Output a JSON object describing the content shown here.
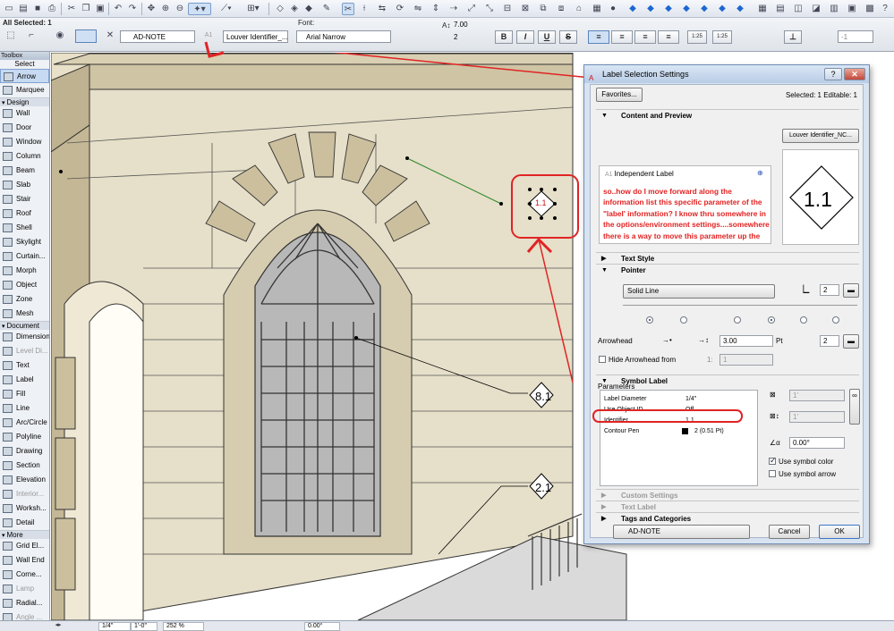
{
  "toolbar": {
    "info_title": "All Selected: 1",
    "layer_value": "AD-NOTE",
    "label_type": "Louver Identifier_...",
    "font_caption": "Font:",
    "font_value": "Arial Narrow",
    "size_value": "7.00",
    "pen_value": "2",
    "bold": "B",
    "italic": "I",
    "underline": "U",
    "strike": "S",
    "scale_a": "1:25",
    "scale_b": "1:25",
    "right_value": "-1"
  },
  "toolbox": {
    "title": "Toolbox",
    "select_caption": "Select",
    "arrow": "Arrow",
    "marquee": "Marquee",
    "design_group": "Design",
    "design_items": [
      "Wall",
      "Door",
      "Window",
      "Column",
      "Beam",
      "Slab",
      "Stair",
      "Roof",
      "Shell",
      "Skylight",
      "Curtain...",
      "Morph",
      "Object",
      "Zone",
      "Mesh"
    ],
    "document_group": "Document",
    "document_items": [
      "Dimension",
      "Level Di...",
      "Text",
      "Label",
      "Fill",
      "Line",
      "Arc/Circle",
      "Polyline",
      "Drawing",
      "Section",
      "Elevation",
      "Interior...",
      "Worksh...",
      "Detail"
    ],
    "more_group": "More",
    "more_items": [
      "Grid El...",
      "Wall End",
      "Corne...",
      "Lamp",
      "Radial...",
      "Angle ..."
    ]
  },
  "status": {
    "scale": "1/4\"",
    "scale_b": "1'-0\"",
    "zoom": "252 %",
    "angle": "0.00°"
  },
  "canvas": {
    "label_a": "8.1",
    "label_b": "2.1",
    "label_c": "1.1"
  },
  "dialog": {
    "title": "Label Selection Settings",
    "favorites": "Favorites...",
    "selected_info": "Selected: 1 Editable: 1",
    "content_section": "Content and Preview",
    "independent_label": "Independent Label",
    "label_dropdown": "Louver Identifier_NC...",
    "preview_value": "1.1",
    "annotation": "so..how do I move forward along the information list this specific parameter of the \"label' information? I know thru somewhere in the options/environment settings....somewhere there is a way to move this parameter up the list of parameters...please explain how to do.",
    "text_style_section": "Text Style",
    "pointer_section": "Pointer",
    "line_type": "Solid Line",
    "pointer_pen": "2",
    "arrowhead_caption": "Arrowhead",
    "arrowhead_size": "3.00",
    "arrowhead_unit": "Pt",
    "arrowhead_pen": "2",
    "hide_arrowhead": "Hide Arrowhead from",
    "hide_from_a": "1:",
    "hide_from_b": "1",
    "symbol_section": "Symbol Label",
    "parameters_caption": "Parameters",
    "params": [
      {
        "name": "Label Diameter",
        "value": "1/4\""
      },
      {
        "name": "Use Object ID",
        "value": "Off"
      },
      {
        "name": "Identifier",
        "value": "1.1"
      },
      {
        "name": "Contour Pen",
        "value": "2 (0.51 Pt)"
      }
    ],
    "width_field": "1'",
    "height_field": "1'",
    "angle_field": "0.00°",
    "use_symbol_color": "Use symbol color",
    "use_symbol_arrow": "Use symbol arrow",
    "custom_settings_section": "Custom Settings",
    "text_label_section": "Text Label",
    "tags_section": "Tags and Categories",
    "layer_value": "AD-NOTE",
    "cancel": "Cancel",
    "ok": "OK"
  }
}
